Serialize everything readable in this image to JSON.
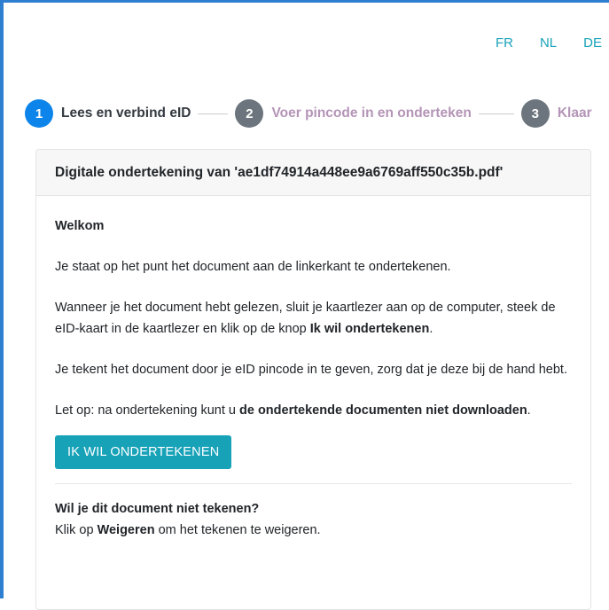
{
  "languages": [
    "FR",
    "NL",
    "DE"
  ],
  "steps": [
    {
      "number": "1",
      "label": "Lees en verbind eID",
      "state": "active"
    },
    {
      "number": "2",
      "label": "Voer pincode in en onderteken",
      "state": "inactive"
    },
    {
      "number": "3",
      "label": "Klaar",
      "state": "inactive"
    }
  ],
  "card": {
    "title": "Digitale ondertekening van 'ae1df74914a448ee9a6769aff550c35b.pdf'",
    "welcome_title": "Welkom",
    "p1": "Je staat op het punt het document aan de linkerkant te ondertekenen.",
    "p2_text": "Wanneer je het document hebt gelezen, sluit je kaartlezer aan op de computer, steek de eID-kaart in de kaartlezer en klik op de knop ",
    "p2_bold": "Ik wil ondertekenen",
    "p2_end": ".",
    "p3": "Je tekent het document door je eID pincode in te geven, zorg dat je deze bij de hand hebt.",
    "p4_text": "Let op: na ondertekening kunt u ",
    "p4_bold": "de ondertekende documenten niet downloaden",
    "p4_end": ".",
    "sign_button": "IK WIL ONDERTEKENEN",
    "refuse_title": "Wil je dit document niet tekenen?",
    "refuse_pre": "Klik op ",
    "refuse_bold": "Weigeren",
    "refuse_post": " om het tekenen te weigeren."
  },
  "colors": {
    "accent": "#17a2b8",
    "step_active": "#0d84ea",
    "step_inactive": "#6c757d",
    "step_label_inactive": "#b494b7",
    "frame": "#2f7fd0"
  }
}
